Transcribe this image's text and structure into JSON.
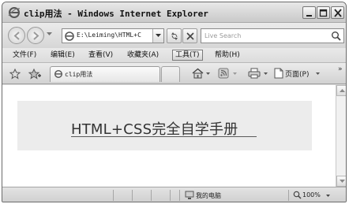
{
  "window": {
    "title": "clip用法 - Windows Internet Explorer"
  },
  "address": {
    "url": "E:\\Leiming\\HTML+C"
  },
  "search": {
    "placeholder": "Live Search"
  },
  "menu": {
    "items": [
      {
        "label": "文件(F)"
      },
      {
        "label": "编辑(E)"
      },
      {
        "label": "查看(V)"
      },
      {
        "label": "收藏夹(A)"
      },
      {
        "label": "工具(T)"
      },
      {
        "label": "帮助(H)"
      }
    ],
    "active_index": 4
  },
  "tab": {
    "label": "clip用法"
  },
  "commands": {
    "page_label": "页面(P)",
    "more": "»"
  },
  "content": {
    "heading": "HTML+CSS完全自学手册"
  },
  "status": {
    "zone": "我的电脑",
    "zoom": "100%"
  },
  "colors": {
    "chrome": "#d9d9d9",
    "content_box": "#ececec",
    "text": "#333333"
  }
}
